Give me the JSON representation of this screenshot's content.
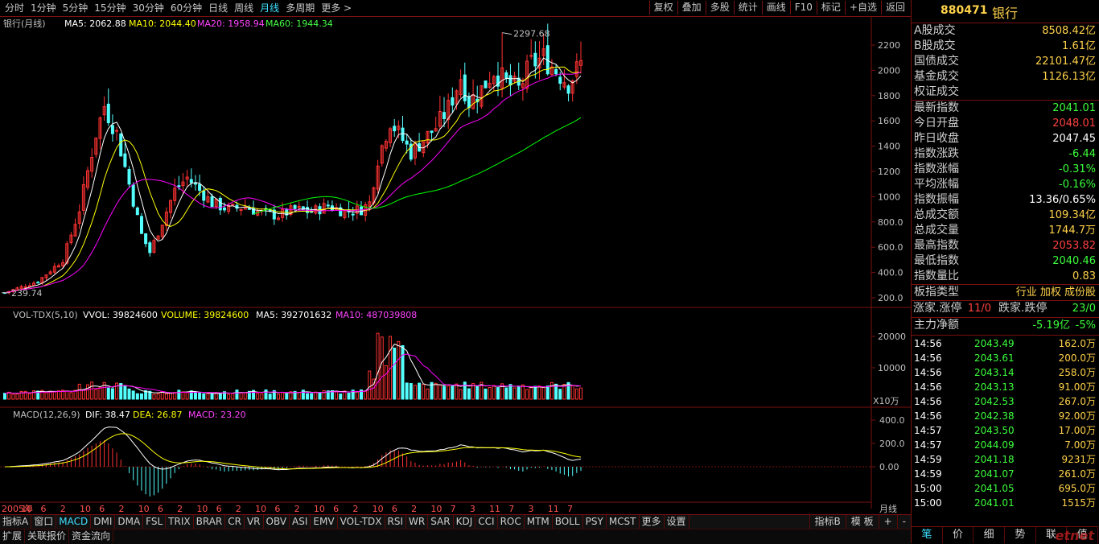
{
  "toolbar": {
    "periods": [
      "分时",
      "1分钟",
      "5分钟",
      "15分钟",
      "30分钟",
      "60分钟",
      "日线",
      "周线",
      "月线",
      "多周期",
      "更多 >"
    ],
    "active_period": "月线",
    "actions": [
      "复权",
      "叠加",
      "多股",
      "统计",
      "画线",
      "F10",
      "标记",
      "+自选",
      "返回"
    ]
  },
  "main": {
    "title": "银行(月线)",
    "ma5_label": "MA5: 2062.88",
    "ma10_label": "MA10: 2044.40",
    "ma20_label": "MA20: 1958.94",
    "ma60_label": "MA60: 1944.34",
    "high_mark": "2297.68",
    "low_mark": "239.74",
    "yticks": [
      "2200",
      "2000",
      "1800",
      "1600",
      "1400",
      "1200",
      "1000",
      "800.0",
      "600.0",
      "400.0",
      "200.0"
    ]
  },
  "volume": {
    "title": "VOL-TDX(5,10)",
    "vvol": "VVOL: 39824600",
    "volume": "VOLUME: 39824600",
    "ma5": "MA5: 392701632",
    "ma10": "MA10: 487039808",
    "yticks": [
      "20000",
      "10000"
    ],
    "unit": "X10万"
  },
  "macd": {
    "title": "MACD(12,26,9)",
    "dif": "DIF: 38.47",
    "dea": "DEA: 26.87",
    "macd": "MACD: 23.20",
    "yticks": [
      "400.0",
      "200.0",
      "0.00"
    ]
  },
  "xaxis": {
    "labels": [
      "2005年",
      "10",
      "6",
      "2",
      "10",
      "6",
      "2",
      "10",
      "6",
      "2",
      "10",
      "6",
      "2",
      "10",
      "6",
      "2",
      "10",
      "6",
      "2",
      "10",
      "6",
      "2",
      "10",
      "7",
      "3",
      "11",
      "7",
      "3",
      "11",
      "7"
    ],
    "period": "月线"
  },
  "tabs_row1": [
    "指标A",
    "窗口",
    "MACD",
    "DMI",
    "DMA",
    "FSL",
    "TRIX",
    "BRAR",
    "CR",
    "VR",
    "OBV",
    "ASI",
    "EMV",
    "VOL-TDX",
    "RSI",
    "WR",
    "SAR",
    "KDJ",
    "CCI",
    "ROC",
    "MTM",
    "BOLL",
    "PSY",
    "MCST",
    "更多",
    "设置"
  ],
  "tabs_row1_active": "MACD",
  "tabs_row1_right": [
    "指标B",
    "模 板",
    "+",
    "-"
  ],
  "tabs_row2": [
    "扩展",
    "关联报价",
    "资金流向"
  ],
  "panel": {
    "code": "880471",
    "name": "银行",
    "turnover": [
      {
        "k": "A股成交",
        "v": "8508.42亿"
      },
      {
        "k": "B股成交",
        "v": "1.61亿"
      },
      {
        "k": "国债成交",
        "v": "22101.47亿"
      },
      {
        "k": "基金成交",
        "v": "1126.13亿"
      },
      {
        "k": "权证成交",
        "v": ""
      }
    ],
    "stats": [
      {
        "k": "最新指数",
        "v": "2041.01",
        "c": "g"
      },
      {
        "k": "今日开盘",
        "v": "2048.01",
        "c": "r"
      },
      {
        "k": "昨日收盘",
        "v": "2047.45",
        "c": "w"
      },
      {
        "k": "指数涨跌",
        "v": "-6.44",
        "c": "g"
      },
      {
        "k": "指数涨幅",
        "v": "-0.31%",
        "c": "g"
      },
      {
        "k": "平均涨幅",
        "v": "-0.16%",
        "c": "g"
      },
      {
        "k": "指数振幅",
        "v": "13.36/0.65%",
        "c": "w"
      },
      {
        "k": "总成交额",
        "v": "109.34亿",
        "c": "y"
      },
      {
        "k": "总成交量",
        "v": "1744.7万",
        "c": "y"
      },
      {
        "k": "最高指数",
        "v": "2053.82",
        "c": "r"
      },
      {
        "k": "最低指数",
        "v": "2040.46",
        "c": "g"
      },
      {
        "k": "指数量比",
        "v": "0.83",
        "c": "y"
      }
    ],
    "type_label": "板指类型",
    "type_value": "行业 加权 成份股",
    "updown_k1": "涨家.涨停",
    "updown_v1": "11/0",
    "updown_k2": "跌家.跌停",
    "updown_v2": "23/0",
    "net_k": "主力净额",
    "net_v": "-5.19亿",
    "net_pct": "-5%",
    "ticks": [
      {
        "t": "14:56",
        "p": "2043.49",
        "v": "162.0万"
      },
      {
        "t": "14:56",
        "p": "2043.61",
        "v": "200.0万"
      },
      {
        "t": "14:56",
        "p": "2043.14",
        "v": "258.0万"
      },
      {
        "t": "14:56",
        "p": "2043.13",
        "v": "91.00万"
      },
      {
        "t": "14:56",
        "p": "2042.53",
        "v": "267.0万"
      },
      {
        "t": "14:56",
        "p": "2042.38",
        "v": "92.00万"
      },
      {
        "t": "14:57",
        "p": "2043.50",
        "v": "17.00万"
      },
      {
        "t": "14:57",
        "p": "2044.09",
        "v": "7.00万"
      },
      {
        "t": "14:59",
        "p": "2041.18",
        "v": "9231万"
      },
      {
        "t": "14:59",
        "p": "2041.07",
        "v": "261.0万"
      },
      {
        "t": "15:00",
        "p": "2041.05",
        "v": "695.0万"
      },
      {
        "t": "15:00",
        "p": "2041.01",
        "v": "1515万"
      }
    ],
    "bottom_tabs": [
      "笔",
      "价",
      "细",
      "势",
      "联",
      "值"
    ],
    "bottom_active": "笔",
    "watermark": "eTime 经济通"
  },
  "colors": {
    "up": "#ff3232",
    "down": "#54ffff",
    "ma5": "#ffffff",
    "ma10": "#ffff00",
    "ma20": "#ff00ff",
    "ma60": "#00ff00",
    "grid": "#7a1010"
  }
}
